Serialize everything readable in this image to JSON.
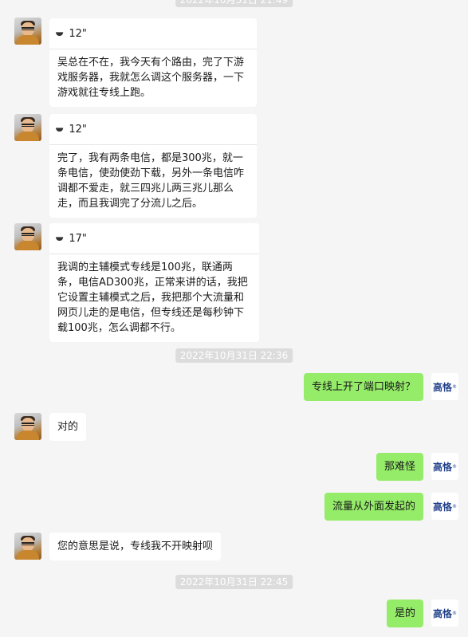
{
  "timestamps": [
    "2022年10月31日 22:36",
    "2022年10月31日 22:45"
  ],
  "me": {
    "avatar_label": "高恪"
  },
  "messages": [
    {
      "duration": "12\"",
      "text": "吴总在不在，我今天有个路由，完了下游戏服务器，我就怎么调这个服务器，一下游戏就往专线上跑。"
    },
    {
      "duration": "12\"",
      "text": "完了，我有两条电信，都是300兆，就一条电信，使劲使劲下载，另外一条电信咋调都不爱走，就三四兆儿两三兆儿那么走，而且我调完了分流儿之后。"
    },
    {
      "duration": "17\"",
      "text": "我调的主辅模式专线是100兆，联通两条，电信AD300兆，正常来讲的话，我把它设置主辅模式之后，我把那个大流量和网页儿走的是电信，但专线还是每秒钟下载100兆，怎么调都不行。"
    },
    {
      "text": "专线上开了端口映射？"
    },
    {
      "text": "对的"
    },
    {
      "text": "那难怪"
    },
    {
      "text": "流量从外面发起的"
    },
    {
      "text": "您的意思是说，专线我不开映射呗"
    },
    {
      "text": "是的"
    }
  ]
}
